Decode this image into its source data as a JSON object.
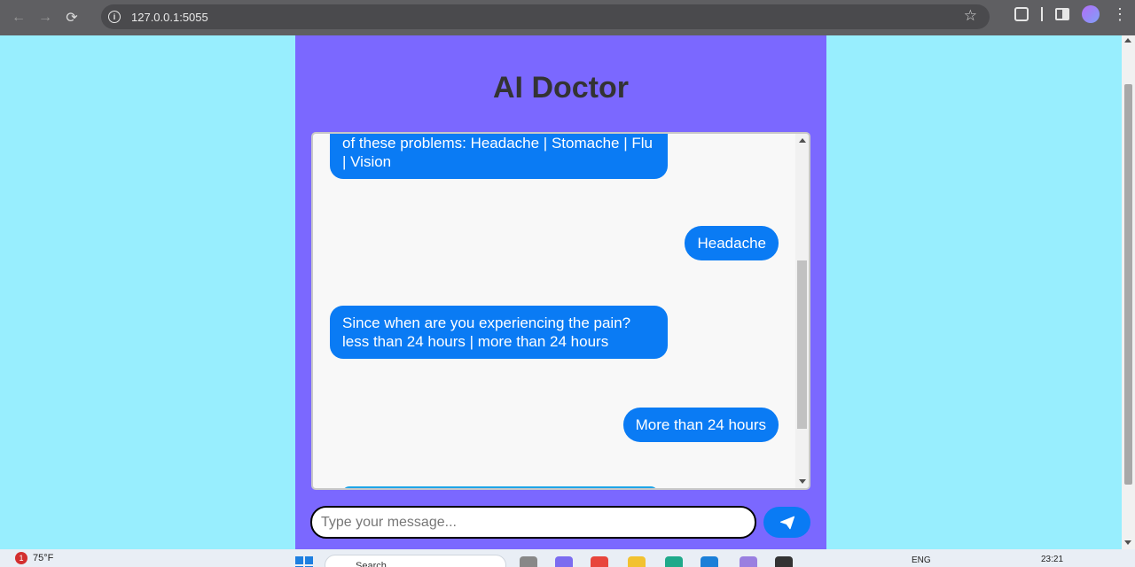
{
  "browser": {
    "url": "127.0.0.1:5055"
  },
  "app": {
    "title": "AI Doctor",
    "messages": [
      {
        "role": "bot",
        "text": "of these problems: Headache | Stomache | Flu | Vision"
      },
      {
        "role": "user",
        "text": "Headache"
      },
      {
        "role": "bot",
        "text": "Since when are you experiencing the pain? less than 24 hours | more than 24 hours"
      },
      {
        "role": "user",
        "text": "More than 24 hours"
      }
    ],
    "input": {
      "placeholder": "Type your message...",
      "value": ""
    },
    "colors": {
      "page_bg": "#98eefe",
      "card_bg": "#7b68ff",
      "bubble": "#0a7bf4"
    }
  },
  "taskbar": {
    "weather": "75°F",
    "weather_badge": "1",
    "search": "Search",
    "language": "ENG",
    "time": "23:21"
  }
}
